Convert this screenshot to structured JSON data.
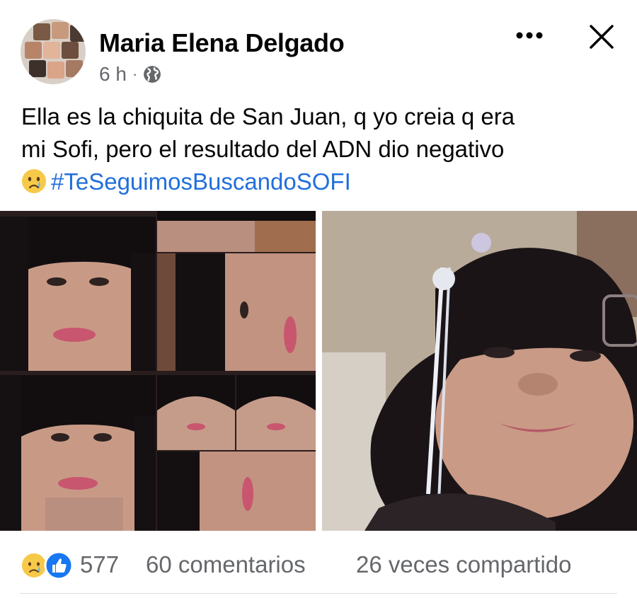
{
  "post": {
    "author": "Maria Elena Delgado",
    "time": "6 h",
    "separator": "·",
    "audience_icon": "globe-icon",
    "text_line1": "Ella es la chiquita de San Juan, q yo creia q era",
    "text_line2": "mi Sofi, pero el resultado del ADN  dio negativo",
    "emoji": "crying-face-emoji",
    "hashtag": "#TeSeguimosBuscandoSOFI"
  },
  "header_actions": {
    "more_icon": "more-horizontal-icon",
    "close_icon": "close-icon"
  },
  "stats": {
    "reaction_icons": [
      "sad-reaction-icon",
      "like-reaction-icon"
    ],
    "reaction_count": "577",
    "comments": "60 comentarios",
    "shares": "26 veces compartido"
  },
  "colors": {
    "text": "#050505",
    "secondary": "#65676b",
    "link": "#216fdb",
    "like_blue": "#1877f2",
    "sad_yellow": "#f7c948"
  }
}
